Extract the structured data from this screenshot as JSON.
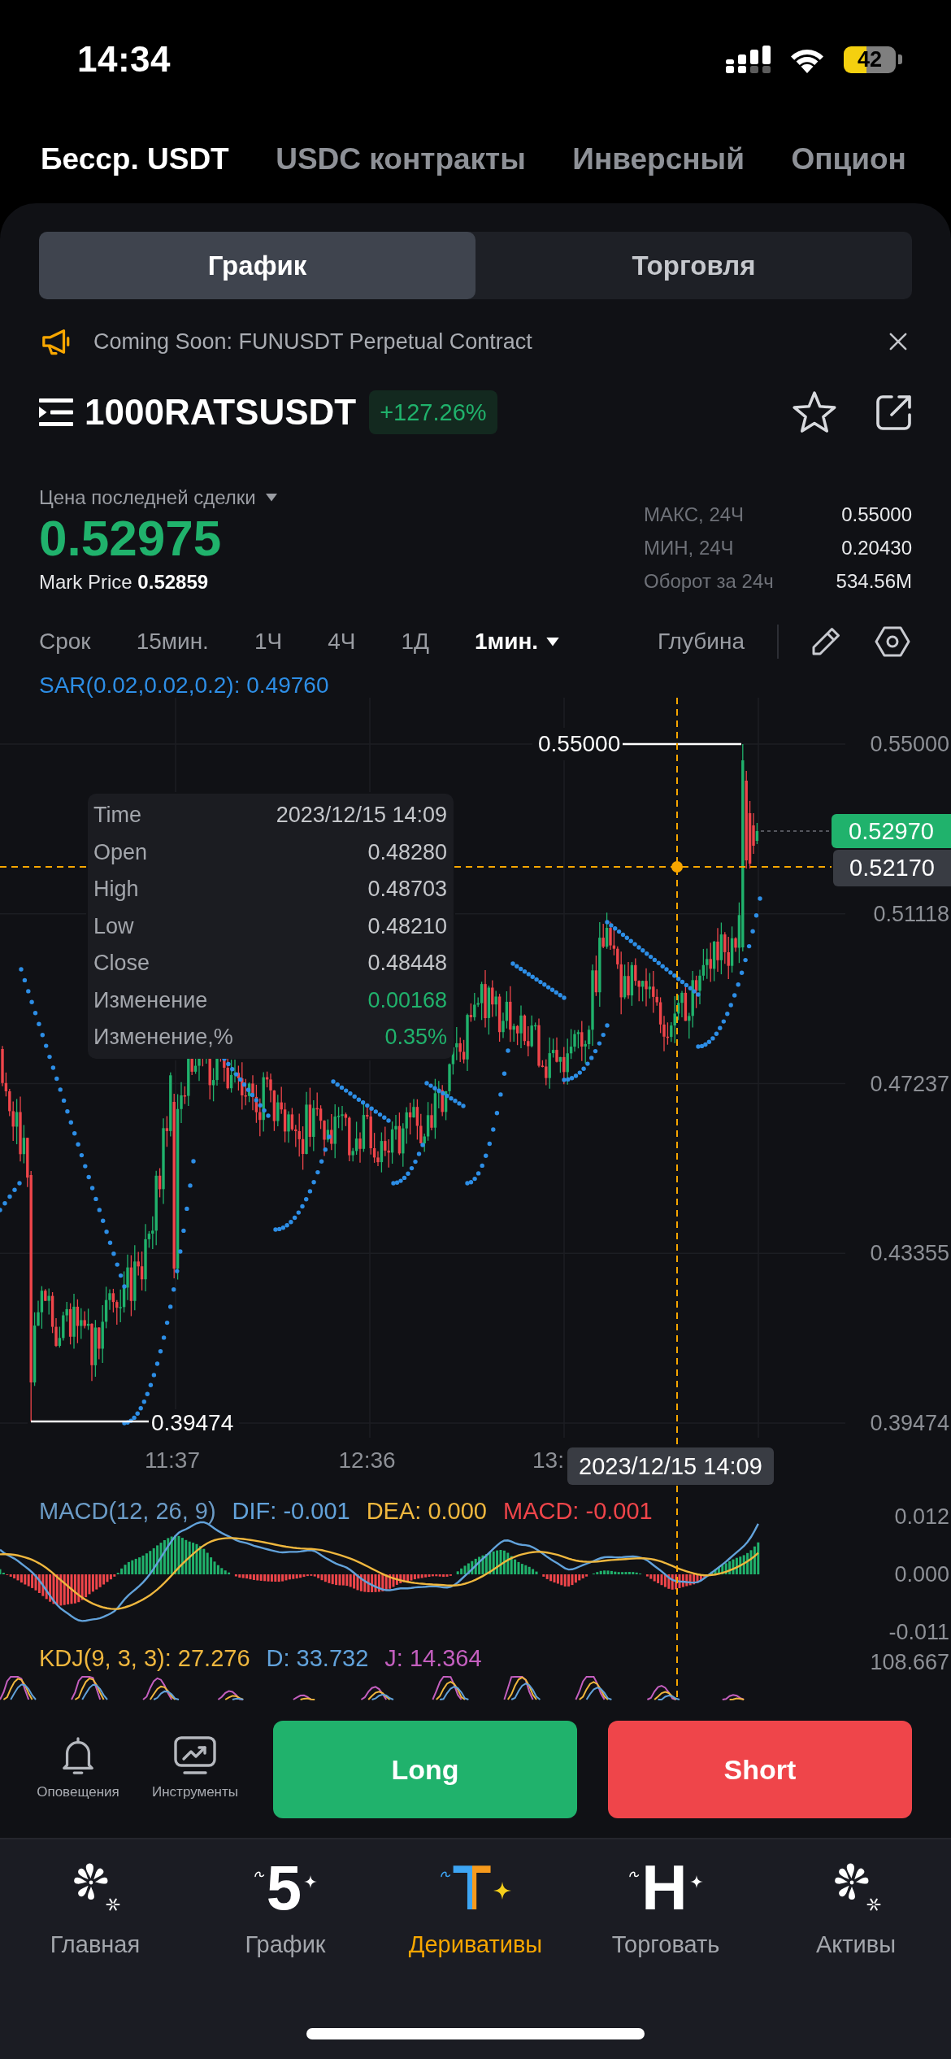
{
  "status_bar": {
    "time": "14:34",
    "battery": "42"
  },
  "market_tabs": [
    {
      "label": "Бесср. USDT",
      "selected": true
    },
    {
      "label": "USDC контракты",
      "selected": false
    },
    {
      "label": "Инверсный",
      "selected": false
    },
    {
      "label": "Опцион",
      "selected": false
    }
  ],
  "view_switch": [
    {
      "label": "График",
      "selected": true
    },
    {
      "label": "Торговля",
      "selected": false
    }
  ],
  "announcement": {
    "text": "Coming Soon: FUNUSDT Perpetual Contract"
  },
  "instrument": {
    "symbol": "1000RATSUSDT",
    "change": "+127.26%"
  },
  "price": {
    "label": "Цена последней сделки",
    "last": "0.52975",
    "mark": "Mark Price **0.52859**"
  },
  "stats_24h": [
    {
      "label": "МАКС, 24Ч",
      "value": "0.55000"
    },
    {
      "label": "МИН, 24Ч",
      "value": "0.20430"
    },
    {
      "label": "Оборот за 24ч",
      "value": "534.56M"
    }
  ],
  "timeframes": [
    {
      "label": "Срок",
      "kind": "option",
      "selected": false
    },
    {
      "label": "15мин.",
      "kind": "option",
      "selected": false
    },
    {
      "label": "1Ч",
      "kind": "option",
      "selected": false
    },
    {
      "label": "4Ч",
      "kind": "option",
      "selected": false
    },
    {
      "label": "1Д",
      "kind": "option",
      "selected": false
    },
    {
      "label": "1мин.",
      "kind": "dropdown",
      "selected": true
    }
  ],
  "depth_tab": {
    "label": "Глубина",
    "selected": false
  },
  "chart": {
    "sar_legend": "SAR(0.02,0.02,0.2): 0.49760",
    "y_axis": [
      "0.55000",
      "0.51118",
      "0.47237",
      "0.43355",
      "0.39474"
    ],
    "x_axis": [
      "11:37",
      "12:36",
      "13:"
    ],
    "high_label": "0.55000",
    "low_label": "0.39474",
    "last_price_tag": "0.52970",
    "crosshair_price_tag": "0.52170",
    "crosshair_time_tag": "2023/12/15 14:09",
    "tooltip": [
      {
        "label": "Time",
        "value": "2023/12/15 14:09",
        "kind": "plain"
      },
      {
        "label": "Open",
        "value": "0.48280",
        "kind": "plain"
      },
      {
        "label": "High",
        "value": "0.48703",
        "kind": "plain"
      },
      {
        "label": "Low",
        "value": "0.48210",
        "kind": "plain"
      },
      {
        "label": "Close",
        "value": "0.48448",
        "kind": "plain"
      },
      {
        "label": "Изменение",
        "value": "0.00168",
        "kind": "change"
      },
      {
        "label": "Изменение,%",
        "value": "0.35%",
        "kind": "change"
      }
    ]
  },
  "macd": {
    "legend": [
      {
        "text": "MACD(12, 26, 9)",
        "color": "#6b9bc6"
      },
      {
        "text": "DIF: -0.001",
        "color": "#62a2da"
      },
      {
        "text": "DEA: 0.000",
        "color": "#efb73e"
      },
      {
        "text": "MACD: -0.001",
        "color": "#ef454a"
      }
    ],
    "y_axis": [
      "0.012",
      "0.000",
      "-0.011"
    ]
  },
  "kdj": {
    "legend": [
      {
        "text": "KDJ(9, 3, 3): 27.276",
        "color": "#efb73e"
      },
      {
        "text": "D: 33.732",
        "color": "#62a2da"
      },
      {
        "text": "J: 14.364",
        "color": "#c45fbf"
      }
    ],
    "y_axis": [
      "108.667"
    ]
  },
  "tools": [
    {
      "label": "Оповещения",
      "kind": "alerts"
    },
    {
      "label": "Инструменты",
      "kind": "tools"
    }
  ],
  "trade_buttons": [
    {
      "label": "Long",
      "kind": "long"
    },
    {
      "label": "Short",
      "kind": "short"
    }
  ],
  "bottom_nav": [
    {
      "label": "Главная",
      "kind": "burst",
      "selected": false
    },
    {
      "label": "График",
      "kind": "glyph",
      "glyph": "5",
      "selected": false
    },
    {
      "label": "Деривативы",
      "kind": "glyph",
      "glyph": "T",
      "selected": true
    },
    {
      "label": "Торговать",
      "kind": "glyph",
      "glyph": "H",
      "selected": false
    },
    {
      "label": "Активы",
      "kind": "burst",
      "selected": false
    }
  ]
}
